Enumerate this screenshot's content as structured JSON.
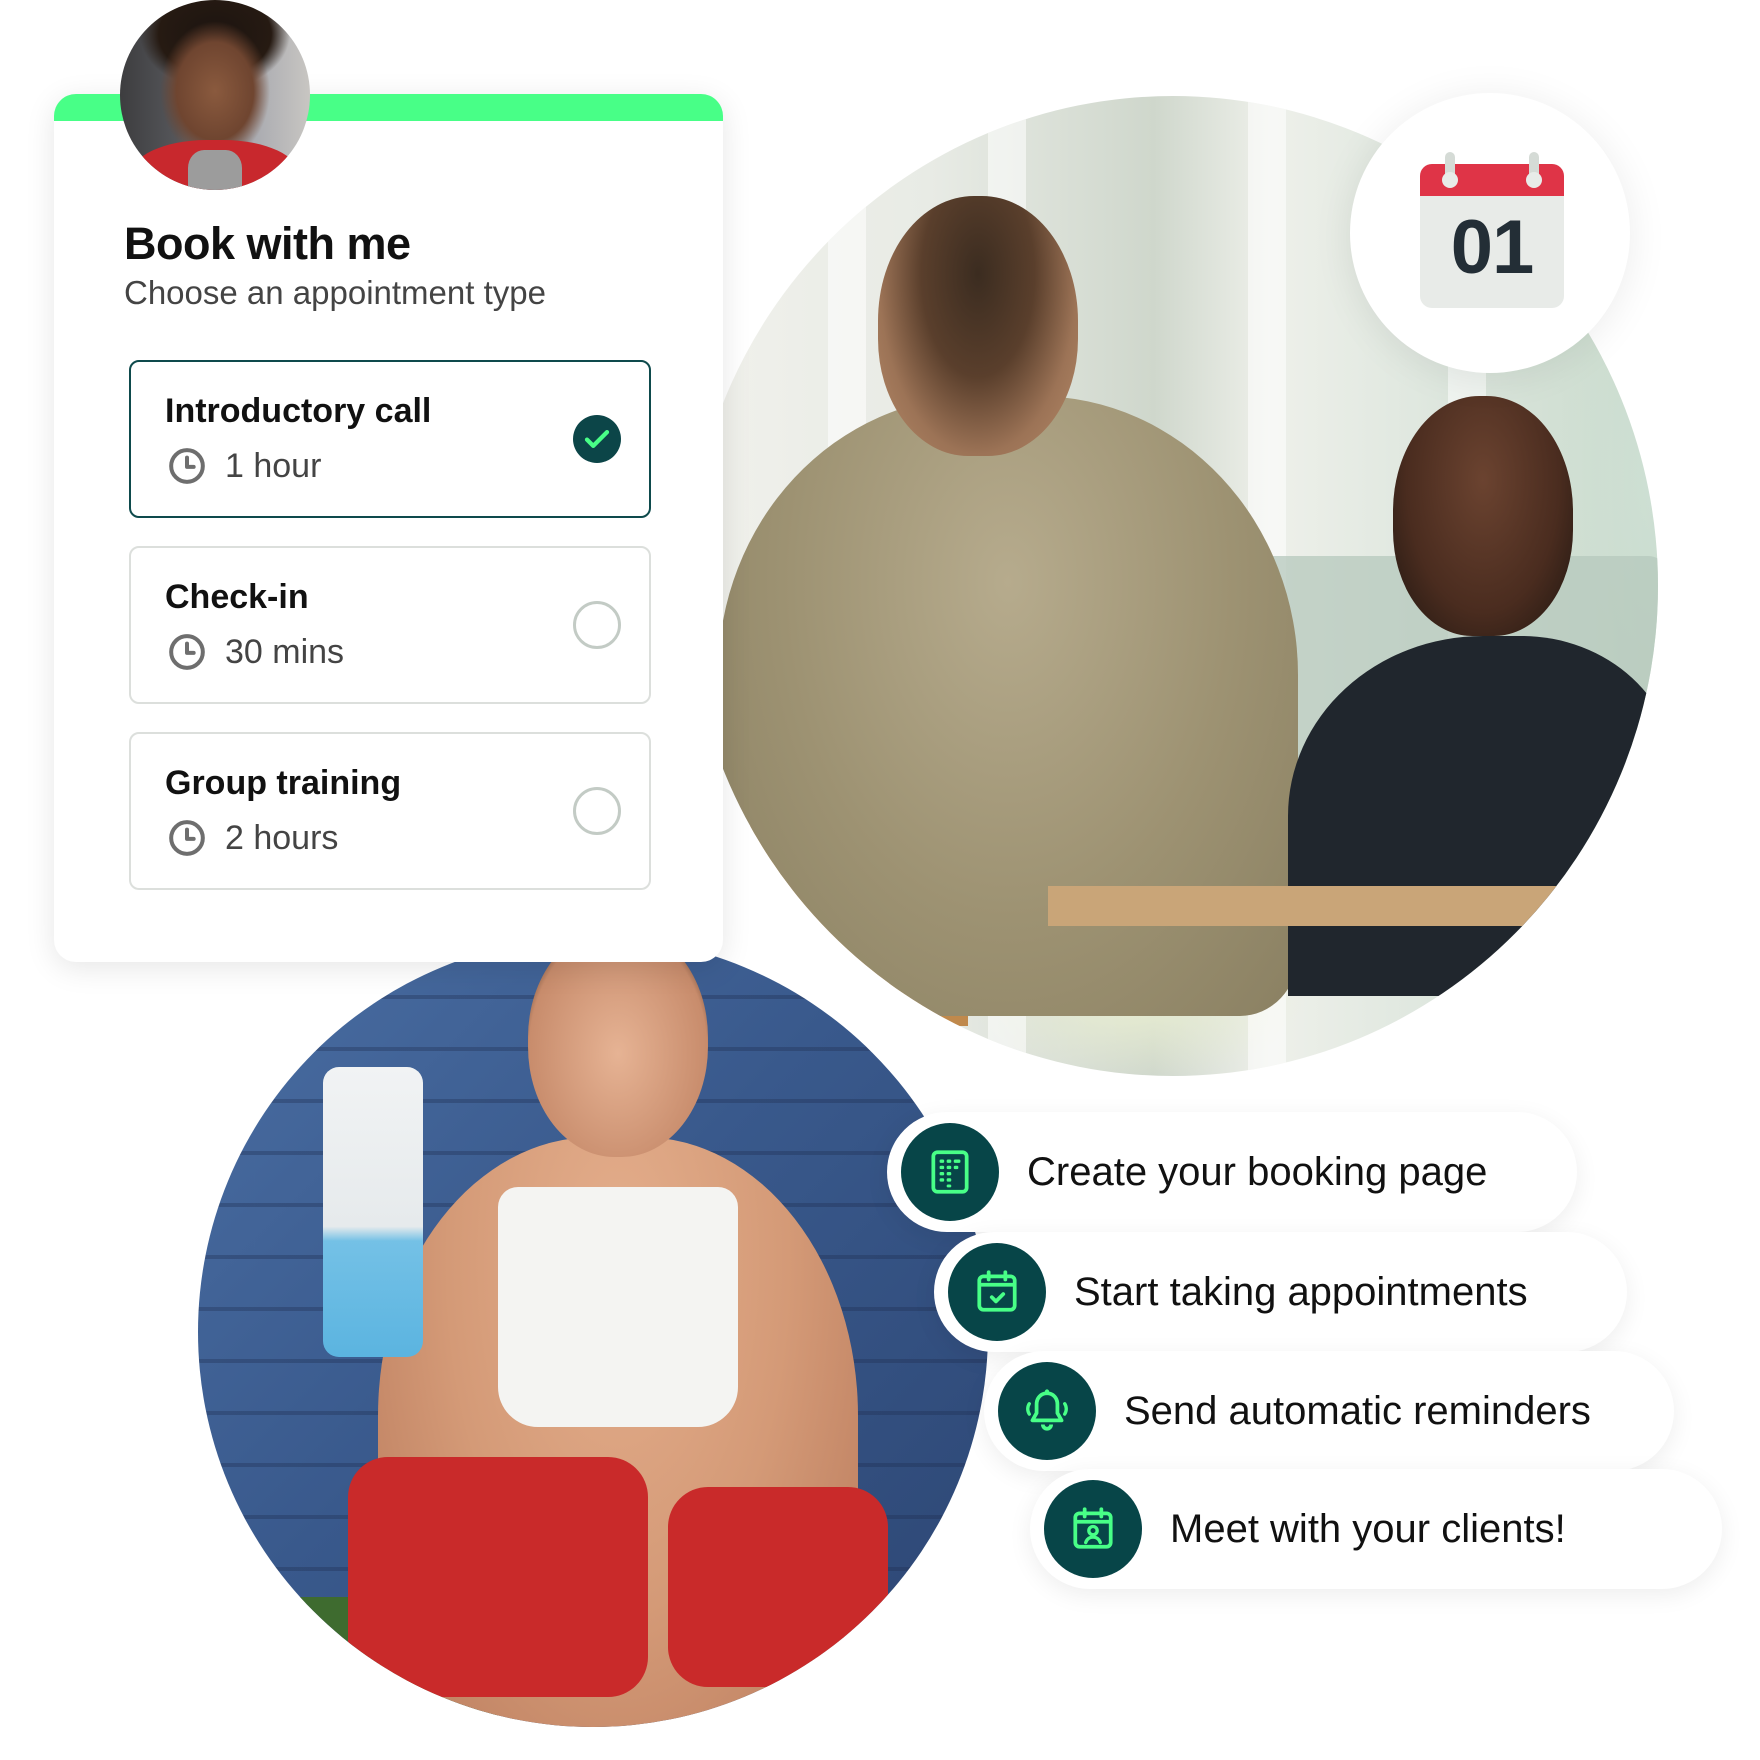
{
  "booking_card": {
    "title": "Book with me",
    "subtitle": "Choose an appointment type",
    "accent_color": "#48ff87",
    "options": [
      {
        "title": "Introductory call",
        "duration": "1 hour",
        "selected": true
      },
      {
        "title": "Check-in",
        "duration": "30 mins",
        "selected": false
      },
      {
        "title": "Group training",
        "duration": "2 hours",
        "selected": false
      }
    ]
  },
  "calendar_badge": {
    "day": "01",
    "header_color": "#df3447"
  },
  "steps": [
    {
      "label": "Create your booking page",
      "icon": "booking-page-icon"
    },
    {
      "label": "Start taking appointments",
      "icon": "calendar-check-icon"
    },
    {
      "label": "Send automatic reminders",
      "icon": "bell-icon"
    },
    {
      "label": "Meet with your clients!",
      "icon": "calendar-user-icon"
    }
  ],
  "colors": {
    "icon_bubble": "#074548",
    "icon_stroke": "#48ff87",
    "selected_border": "#0e4a4c"
  }
}
